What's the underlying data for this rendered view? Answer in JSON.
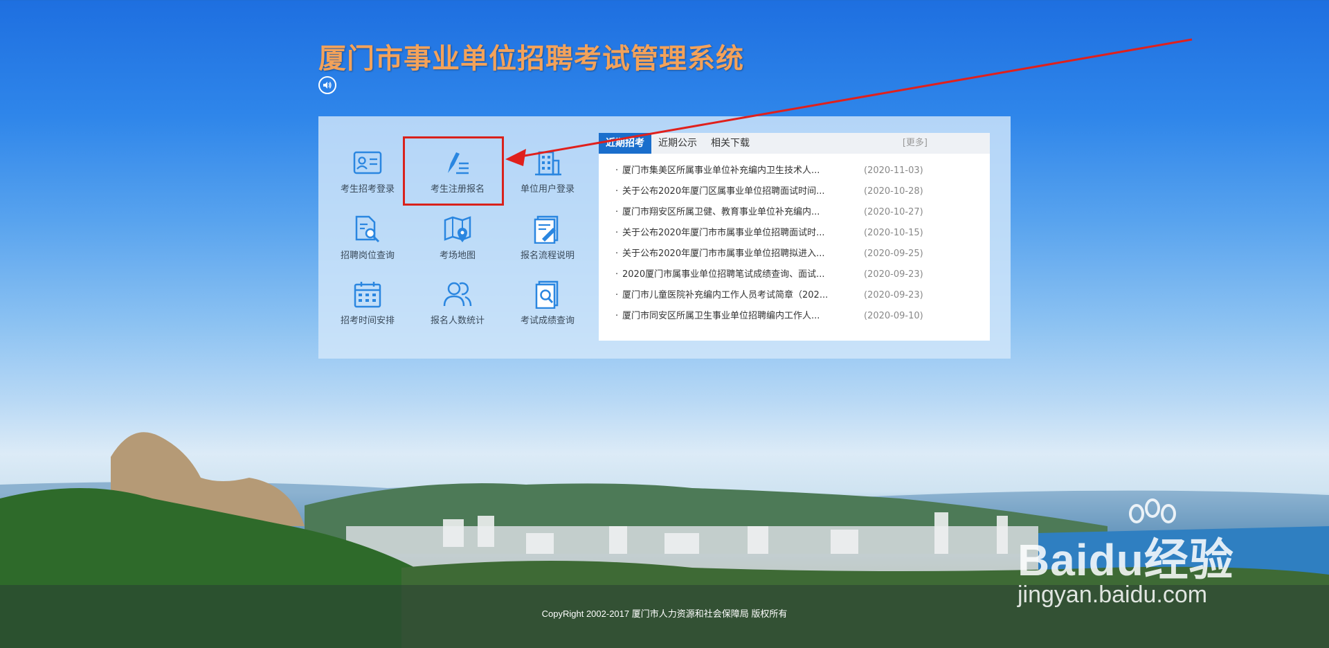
{
  "header": {
    "title": "厦门市事业单位招聘考试管理系统"
  },
  "menu": [
    {
      "label": "考生招考登录",
      "icon": "id-card-icon"
    },
    {
      "label": "考生注册报名",
      "icon": "pen-list-icon"
    },
    {
      "label": "单位用户登录",
      "icon": "building-icon"
    },
    {
      "label": "招聘岗位查询",
      "icon": "document-search-icon"
    },
    {
      "label": "考场地图",
      "icon": "map-pin-icon"
    },
    {
      "label": "报名流程说明",
      "icon": "edit-document-icon"
    },
    {
      "label": "招考时间安排",
      "icon": "calendar-icon"
    },
    {
      "label": "报名人数统计",
      "icon": "users-icon"
    },
    {
      "label": "考试成绩查询",
      "icon": "result-search-icon"
    }
  ],
  "news": {
    "tabs": [
      "近期招考",
      "近期公示",
      "相关下载"
    ],
    "active_tab": "近期招考",
    "more_label": "[更多]",
    "items": [
      {
        "title": "厦门市集美区所属事业单位补充编内卫生技术人...",
        "date": "(2020-11-03)"
      },
      {
        "title": "关于公布2020年厦门区属事业单位招聘面试时间...",
        "date": "(2020-10-28)"
      },
      {
        "title": "厦门市翔安区所属卫健、教育事业单位补充编内...",
        "date": "(2020-10-27)"
      },
      {
        "title": "关于公布2020年厦门市市属事业单位招聘面试时...",
        "date": "(2020-10-15)"
      },
      {
        "title": "关于公布2020年厦门市市属事业单位招聘拟进入...",
        "date": "(2020-09-25)"
      },
      {
        "title": "2020厦门市属事业单位招聘笔试成绩查询、面试...",
        "date": "(2020-09-23)"
      },
      {
        "title": "厦门市儿童医院补充编内工作人员考试简章（202...",
        "date": "(2020-09-23)"
      },
      {
        "title": "厦门市同安区所属卫生事业单位招聘编内工作人...",
        "date": "(2020-09-10)"
      }
    ]
  },
  "footer": {
    "copyright": "CopyRight 2002-2017 厦门市人力资源和社会保障局 版权所有"
  },
  "watermark": {
    "logo_text": "Baidu经验",
    "url": "jingyan.baidu.com"
  },
  "colors": {
    "accent": "#1a6ecc",
    "title": "#f3a25a",
    "highlight": "#d9211b",
    "arrow": "#e0201c"
  }
}
